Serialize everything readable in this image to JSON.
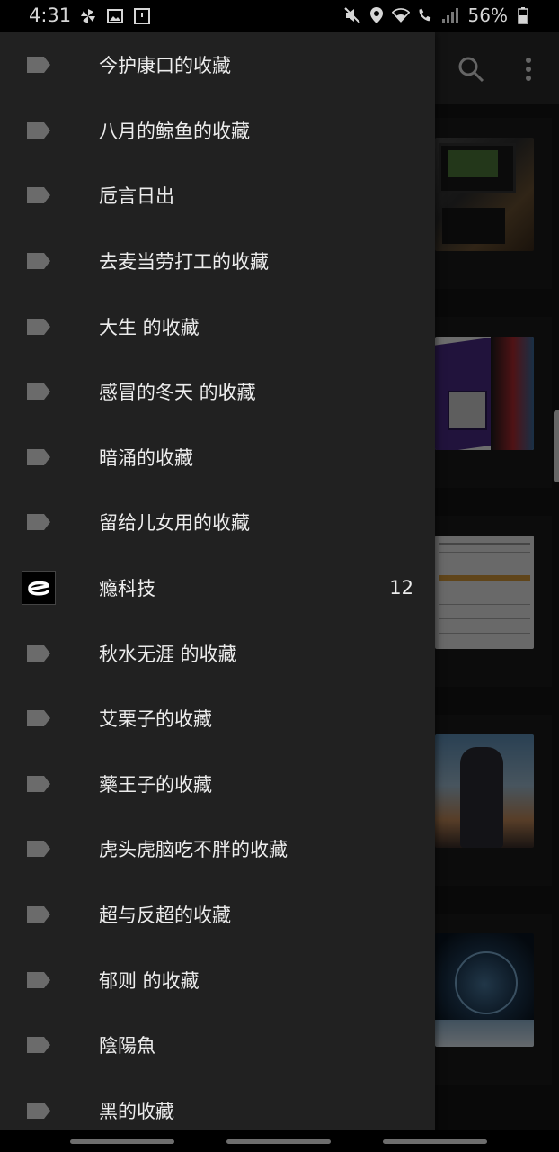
{
  "status_bar": {
    "time": "4:31",
    "left_icons": [
      "pinwheel-icon",
      "image-icon",
      "screenshot-icon"
    ],
    "right_icons": [
      "mute-icon",
      "location-icon",
      "wifi-icon",
      "wifi-calling-icon",
      "signal-icon",
      "battery-icon"
    ],
    "battery": "56%"
  },
  "background_app": {
    "appbar_icons": [
      "search-icon",
      "more-vert-icon"
    ],
    "thumbnail_count": 5
  },
  "drawer": {
    "items": [
      {
        "label": "今护康口的收藏",
        "icon": "tag-icon",
        "count": ""
      },
      {
        "label": "八月的鲸鱼的收藏",
        "icon": "tag-icon",
        "count": ""
      },
      {
        "label": "卮言日出",
        "icon": "tag-icon",
        "count": ""
      },
      {
        "label": "去麦当劳打工的收藏",
        "icon": "tag-icon",
        "count": ""
      },
      {
        "label": "大生 的收藏",
        "icon": "tag-icon",
        "count": ""
      },
      {
        "label": "感冒的冬天 的收藏",
        "icon": "tag-icon",
        "count": ""
      },
      {
        "label": "暗涌的收藏",
        "icon": "tag-icon",
        "count": ""
      },
      {
        "label": "留给儿女用的收藏",
        "icon": "tag-icon",
        "count": ""
      },
      {
        "label": "瘾科技",
        "icon": "engadget-logo-icon",
        "count": "12"
      },
      {
        "label": "秋水无涯 的收藏",
        "icon": "tag-icon",
        "count": ""
      },
      {
        "label": "艾栗子的收藏",
        "icon": "tag-icon",
        "count": ""
      },
      {
        "label": "藥王子的收藏",
        "icon": "tag-icon",
        "count": ""
      },
      {
        "label": "虎头虎脑吃不胖的收藏",
        "icon": "tag-icon",
        "count": ""
      },
      {
        "label": "超与反超的收藏",
        "icon": "tag-icon",
        "count": ""
      },
      {
        "label": "郁则 的收藏",
        "icon": "tag-icon",
        "count": ""
      },
      {
        "label": "陰陽魚",
        "icon": "tag-icon",
        "count": ""
      },
      {
        "label": "黑的收藏",
        "icon": "tag-icon",
        "count": ""
      }
    ]
  },
  "colors": {
    "drawer_bg": "#212121",
    "icon_gray": "#6b6b6b",
    "text": "#ececec"
  }
}
